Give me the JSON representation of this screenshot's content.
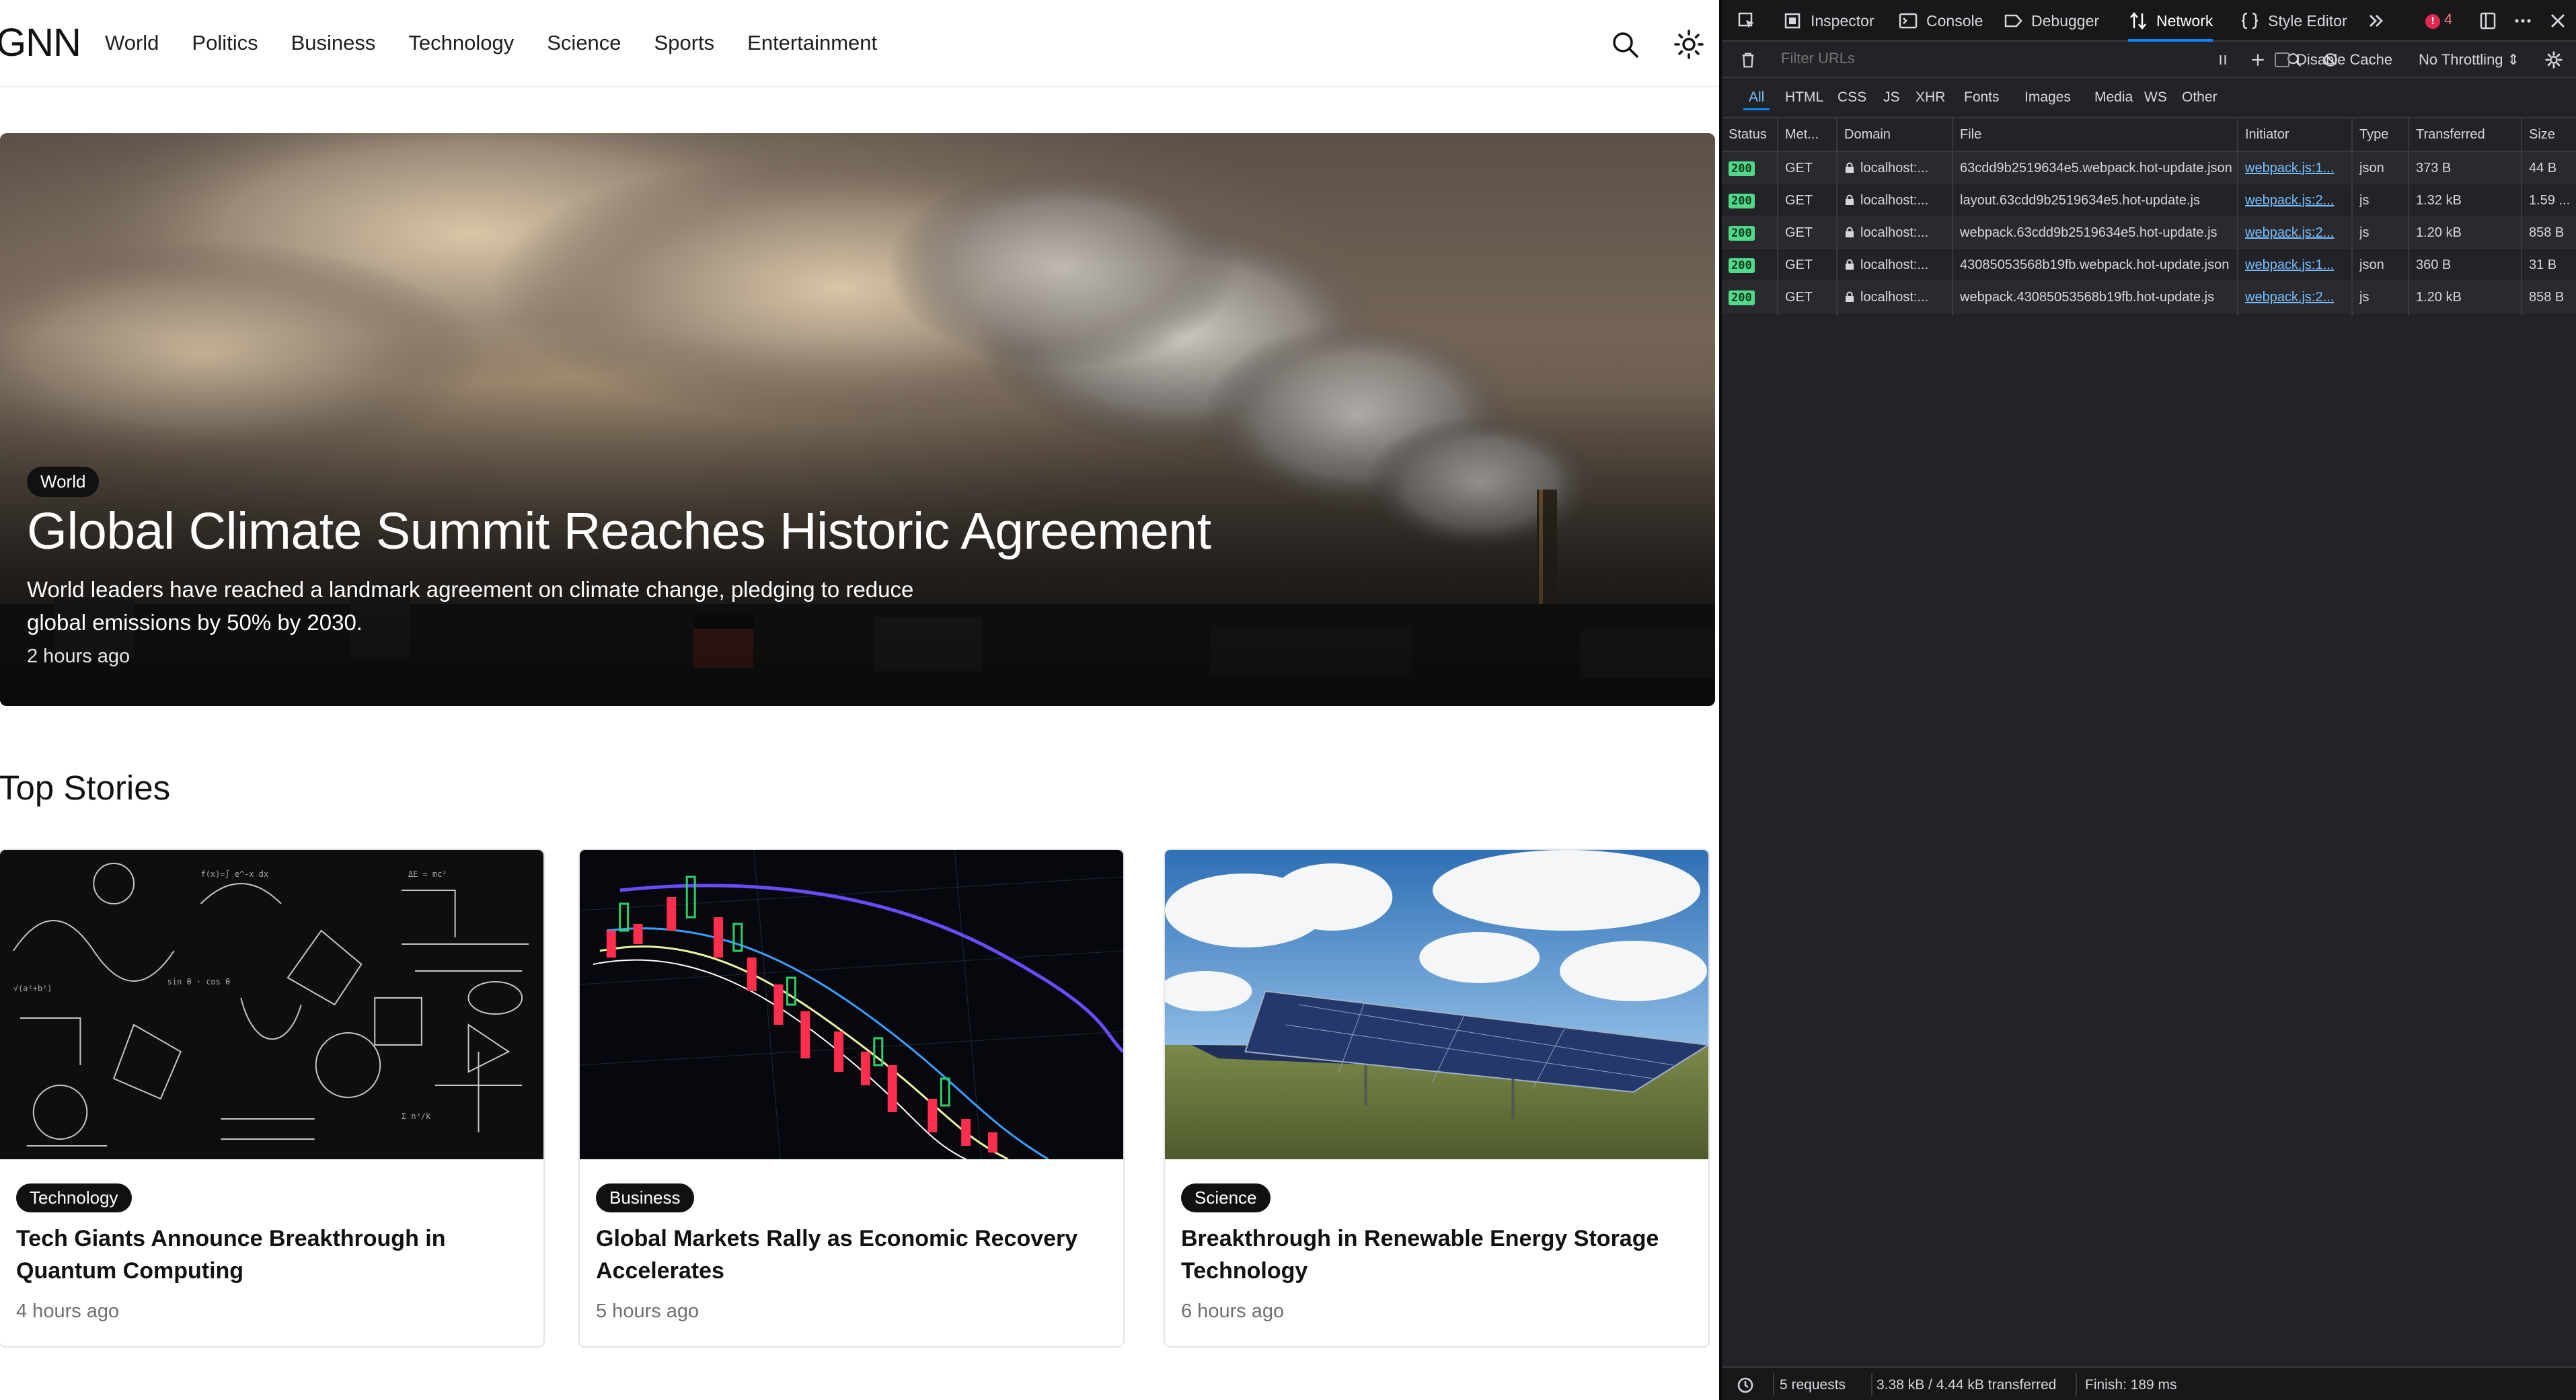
{
  "site": {
    "logo": "GNN",
    "nav": [
      "World",
      "Politics",
      "Business",
      "Technology",
      "Science",
      "Sports",
      "Entertainment"
    ],
    "icons": [
      "search-icon",
      "sun-icon"
    ]
  },
  "hero": {
    "category": "World",
    "title": "Global Climate Summit Reaches Historic Agreement",
    "description": "World leaders have reached a landmark agreement on climate change, pledging to reduce global emissions by 50% by 2030.",
    "time": "2 hours ago"
  },
  "top_stories": {
    "heading": "Top Stories",
    "cards": [
      {
        "category": "Technology",
        "title": "Tech Giants Announce Breakthrough in Quantum Computing",
        "time": "4 hours ago"
      },
      {
        "category": "Business",
        "title": "Global Markets Rally as Economic Recovery Accelerates",
        "time": "5 hours ago"
      },
      {
        "category": "Science",
        "title": "Breakthrough in Renewable Energy Storage Technology",
        "time": "6 hours ago"
      }
    ]
  },
  "devtools": {
    "tabs": [
      "Inspector",
      "Console",
      "Debugger",
      "Network",
      "Style Editor"
    ],
    "active_tab": "Network",
    "error_count": "4",
    "filter_placeholder": "Filter URLs",
    "disable_cache": "Disable Cache",
    "throttling": "No Throttling ⇕",
    "type_filters": [
      "All",
      "HTML",
      "CSS",
      "JS",
      "XHR",
      "Fonts",
      "Images",
      "Media",
      "WS",
      "Other"
    ],
    "columns": [
      "Status",
      "Met...",
      "Domain",
      "File",
      "Initiator",
      "Type",
      "Transferred",
      "Size"
    ],
    "requests": [
      {
        "status": "200",
        "method": "GET",
        "domain": "localhost:...",
        "file": "63cdd9b2519634e5.webpack.hot-update.json",
        "initiator": "webpack.js:1...",
        "type": "json",
        "transferred": "373 B",
        "size": "44 B"
      },
      {
        "status": "200",
        "method": "GET",
        "domain": "localhost:...",
        "file": "layout.63cdd9b2519634e5.hot-update.js",
        "initiator": "webpack.js:2...",
        "type": "js",
        "transferred": "1.32 kB",
        "size": "1.59 ..."
      },
      {
        "status": "200",
        "method": "GET",
        "domain": "localhost:...",
        "file": "webpack.63cdd9b2519634e5.hot-update.js",
        "initiator": "webpack.js:2...",
        "type": "js",
        "transferred": "1.20 kB",
        "size": "858 B"
      },
      {
        "status": "200",
        "method": "GET",
        "domain": "localhost:...",
        "file": "43085053568b19fb.webpack.hot-update.json",
        "initiator": "webpack.js:1...",
        "type": "json",
        "transferred": "360 B",
        "size": "31 B"
      },
      {
        "status": "200",
        "method": "GET",
        "domain": "localhost:...",
        "file": "webpack.43085053568b19fb.hot-update.js",
        "initiator": "webpack.js:2...",
        "type": "js",
        "transferred": "1.20 kB",
        "size": "858 B"
      }
    ],
    "summary": {
      "requests": "5 requests",
      "transferred": "3.38 kB / 4.44 kB transferred",
      "finish": "Finish: 189 ms"
    }
  }
}
